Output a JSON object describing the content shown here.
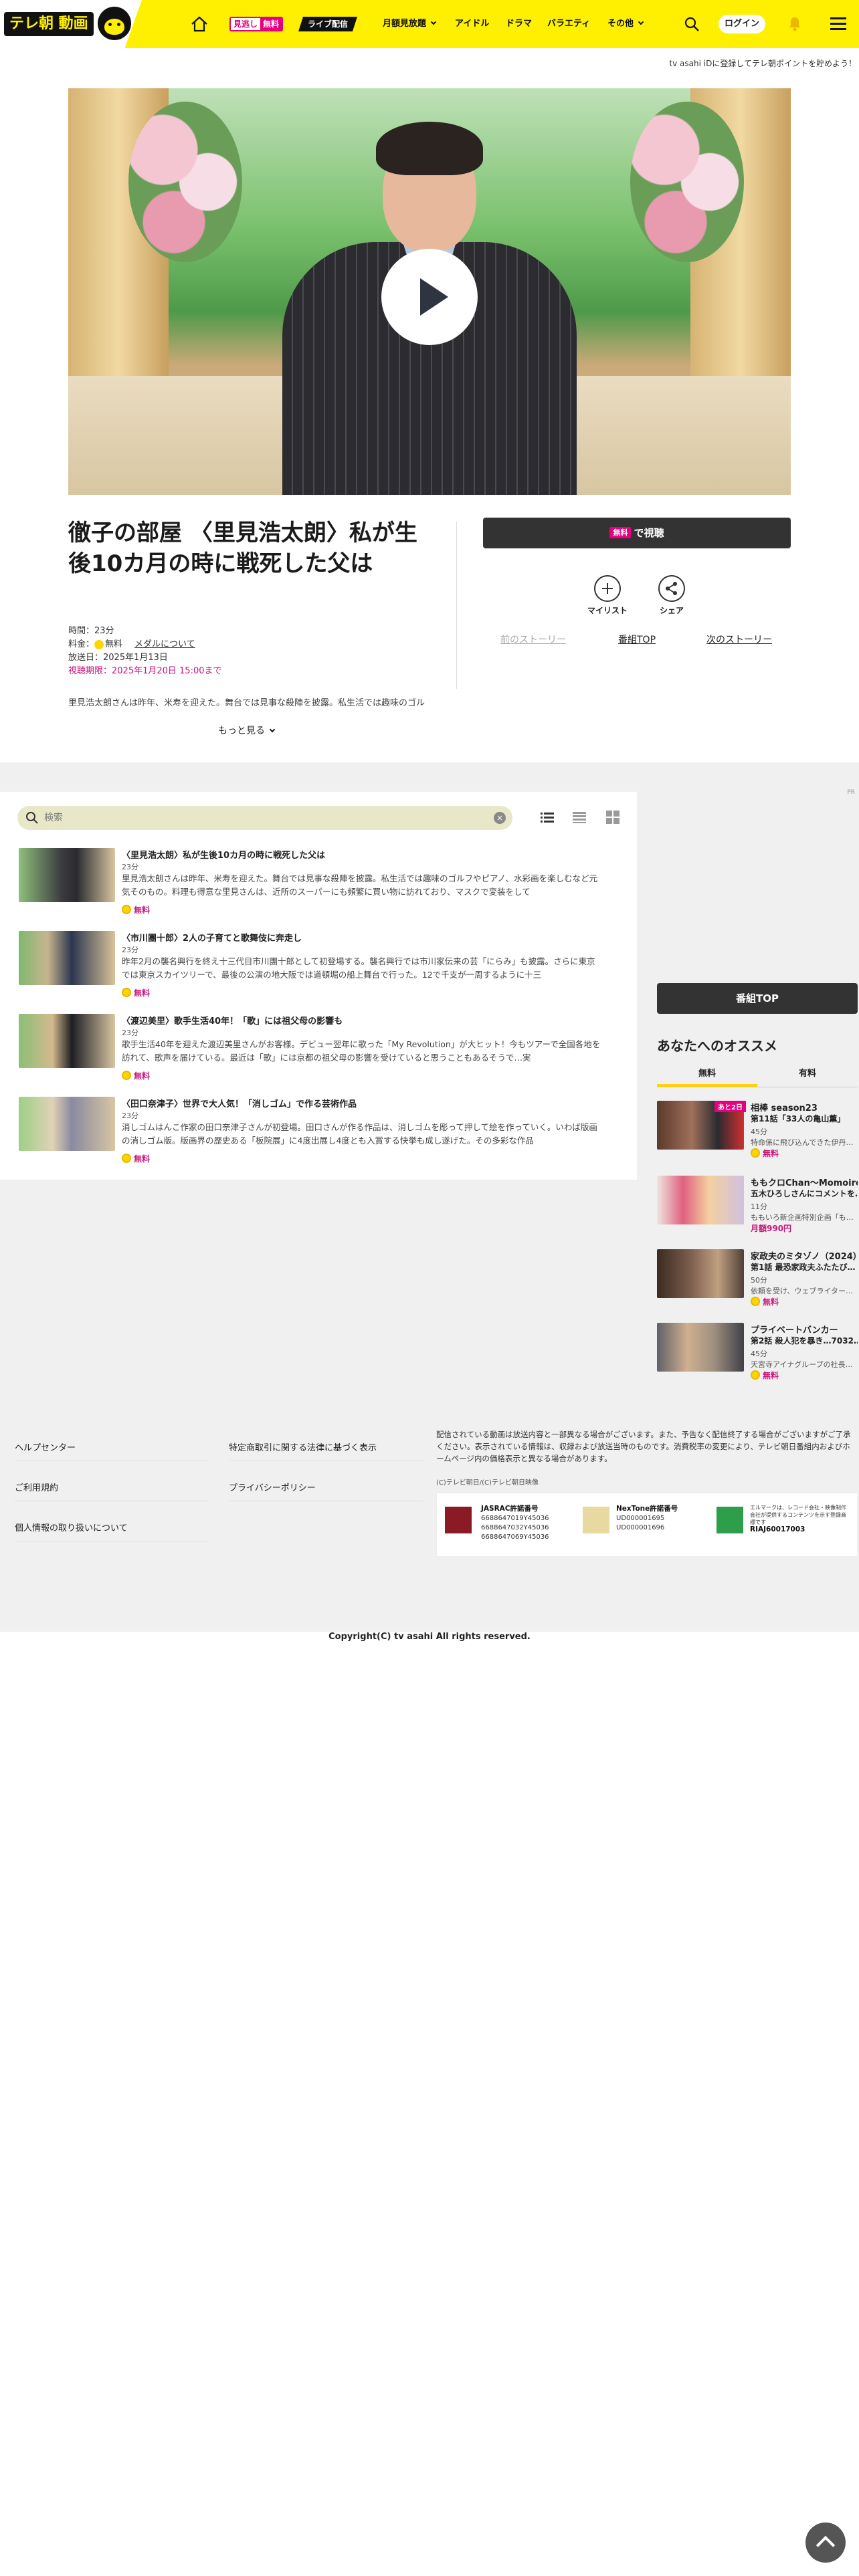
{
  "header": {
    "logo_text": "テレ朝 動画",
    "nav_miru_a": "見逃し",
    "nav_miru_b": "無料",
    "nav_live": "ライブ配信",
    "nav_items": [
      "月額見放題",
      "アイドル",
      "ドラマ",
      "バラエティ",
      "その他"
    ],
    "login": "ログイン",
    "banner": "tv asahi iDに登録してテレ朝ポイントを貯めよう！"
  },
  "episode": {
    "title": "徹子の部屋 〈里見浩太朗〉私が生後10カ月の時に戦死した父は",
    "duration": "時間：23分",
    "price_label": "料金：",
    "price_free": "無料",
    "medal_link": "メダルについて",
    "air_date": "放送日：2025年1月13日",
    "deadline": "視聴期限：2025年1月20日 15:00まで",
    "description": "里見浩太朗さんは昨年、米寿を迎えた。舞台では見事な殺陣を披露。私生活では趣味のゴル",
    "more": "もっと見る"
  },
  "actions": {
    "watch_badge": "無料",
    "watch_label": "で視聴",
    "mylist": "マイリスト",
    "share": "シェア",
    "prev": "前のストーリー",
    "top": "番組TOP",
    "next": "次のストーリー"
  },
  "list": {
    "search_placeholder": "検索",
    "ad_mark": "PR",
    "episodes": [
      {
        "title": "〈里見浩太朗〉私が生後10カ月の時に戦死した父は",
        "duration": "23分",
        "desc": "里見浩太朗さんは昨年、米寿を迎えた。舞台では見事な殺陣を披露。私生活では趣味のゴルフやピアノ、水彩画を楽しむなど元気そのもの。料理も得意な里見さんは、近所のスーパーにも頻繁に買い物に訪れており、マスクで変装をして",
        "free": "無料"
      },
      {
        "title": "〈市川團十郎〉2人の子育てと歌舞伎に奔走し",
        "duration": "23分",
        "desc": "昨年2月の襲名興行を終え十三代目市川團十郎として初登場する。襲名興行では市川家伝来の芸「にらみ」も披露。さらに東京では東京スカイツリーで、最後の公演の地大阪では道頓堀の船上舞台で行った。12で千支が一周するように十三",
        "free": "無料"
      },
      {
        "title": "〈渡辺美里〉歌手生活40年！「歌」には祖父母の影響も",
        "duration": "23分",
        "desc": "歌手生活40年を迎えた渡辺美里さんがお客様。デビュー翌年に歌った「My Revolution」が大ヒット！今もツアーで全国各地を訪れて、歌声を届けている。最近は「歌」には京都の祖父母の影響を受けていると思うこともあるそうで…実",
        "free": "無料"
      },
      {
        "title": "〈田口奈津子〉世界で大人気！「消しゴム」で作る芸術作品",
        "duration": "23分",
        "desc": "消しゴムはんこ作家の田口奈津子さんが初登場。田口さんが作る作品は、消しゴムを彫って押して絵を作っていく。いわば版画の消しゴム版。版画界の歴史ある「板院展」に4度出展し4度とも入賞する快挙も成し遂げた。その多彩な作品",
        "free": "無料"
      }
    ]
  },
  "sidebar": {
    "top_button": "番組TOP",
    "heading": "あなたへのオススメ",
    "tab_free": "無料",
    "tab_paid": "有料",
    "items": [
      {
        "new": "あと2日",
        "title": "相棒 season23",
        "ep": "第11話「33人の亀山薫」",
        "dur": "45分",
        "desc": "特命係に飛び込んできた伊丹…",
        "price": "無料"
      },
      {
        "new": "",
        "title": "ももクロChan～Momoiro Clover Z Channel～",
        "ep": "五木ひろしさんにコメントを…",
        "dur": "11分",
        "desc": "ももいろ新企画特別企画「も…",
        "price": "月額990円"
      },
      {
        "new": "",
        "title": "家政夫のミタゾノ（2024）",
        "ep": "第1話 最恐家政夫ふたたび…",
        "dur": "50分",
        "desc": "依頼を受け、ウェブライター…",
        "price": "無料"
      },
      {
        "new": "",
        "title": "プライベートバンカー",
        "ep": "第2話 殺人犯を暴き…7032…",
        "dur": "45分",
        "desc": "天宮寺アイナグループの社長…",
        "price": "無料"
      }
    ]
  },
  "footer": {
    "links_left": [
      "ヘルプセンター",
      "ご利用規約",
      "個人情報の取り扱いについて"
    ],
    "links_right": [
      "特定商取引に関する法律に基づく表示",
      "プライバシーポリシー"
    ],
    "note": "配信されている動画は放送内容と一部異なる場合がございます。また、予告なく配信終了する場合がございますがご了承ください。表示されている情報は、収録および放送当時のものです。消費税率の変更により、テレビ朝日番組内およびホームページ内の価格表示と異なる場合があります。",
    "copy_small": "(C)テレビ朝日/(C)テレビ朝日映像",
    "jasrac_title": "JASRAC許諾番号",
    "jasrac_nums": [
      "6688647019Y45036",
      "6688647032Y45036",
      "6688647069Y45036"
    ],
    "nextone_title": "NexTone許諾番号",
    "nextone_nums": [
      "UD000001695",
      "UD000001696"
    ],
    "lmark_text": "エルマークは、レコード会社・映像制作会社が提供するコンテンツを示す登録商標です",
    "lmark_num": "RIAJ60017003",
    "copyright": "Copyright(C) tv asahi All rights reserved."
  },
  "colors": {
    "brand_yellow": "#ffef00",
    "accent_pink": "#e4007f",
    "coin_yellow": "#ffd500"
  }
}
